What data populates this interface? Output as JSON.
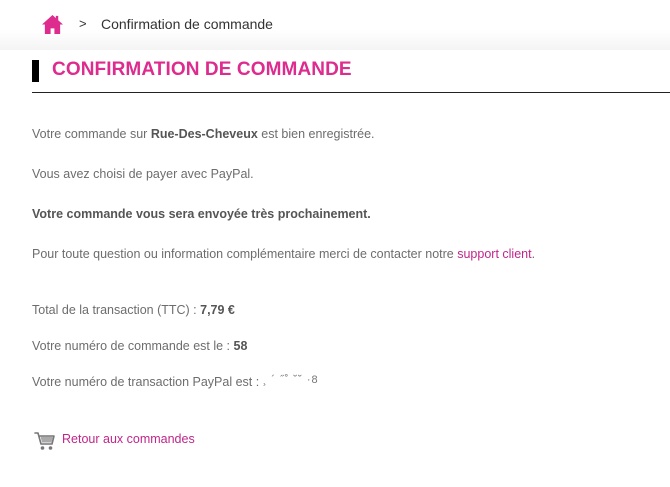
{
  "colors": {
    "accent": "#dd2b8e",
    "link": "#c0268a",
    "text": "#6d6d6d"
  },
  "breadcrumb": {
    "home_icon": "home-icon",
    "separator": ">",
    "current": "Confirmation de commande"
  },
  "page": {
    "title": "CONFIRMATION DE COMMANDE"
  },
  "message": {
    "line1_pre": "Votre commande sur ",
    "line1_shop": "Rue-Des-Cheveux",
    "line1_post": " est bien enregistrée.",
    "line2": "Vous avez choisi de payer avec PayPal.",
    "line3": "Votre commande vous sera envoyée très prochainement.",
    "line4_pre": "Pour toute question ou information complémentaire merci de contacter notre ",
    "line4_link": "support client",
    "line4_post": "."
  },
  "summary": {
    "total_label": "Total de la transaction (TTC) : ",
    "total_value": "7,79 €",
    "order_label": "Votre numéro de commande est le : ",
    "order_value": "58",
    "paypal_label": "Votre numéro de transaction PayPal est : ",
    "paypal_value_masked": "¸ ´ ˝˚ ˘˘ ·8"
  },
  "back": {
    "icon": "cart-icon",
    "label": "Retour aux commandes"
  }
}
